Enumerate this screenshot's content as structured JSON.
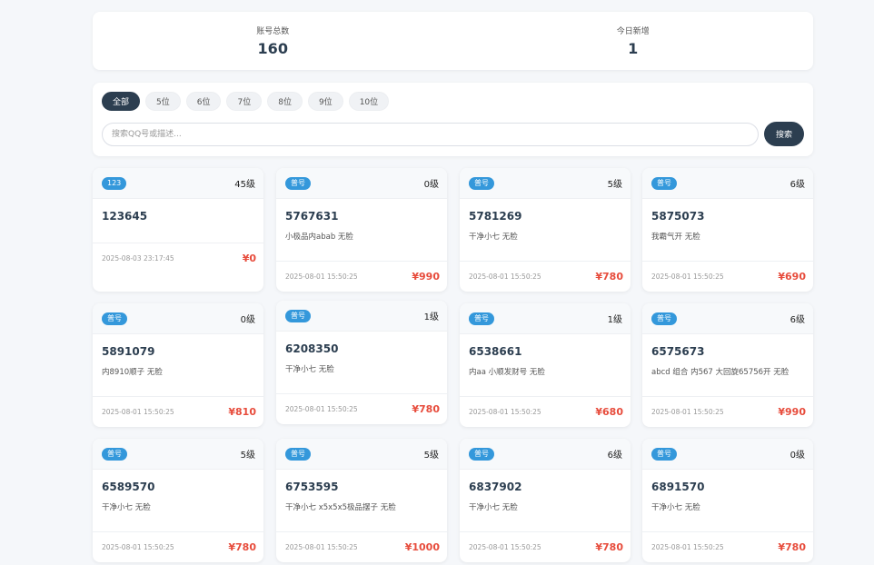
{
  "stats": {
    "total_label": "账号总数",
    "total_value": "160",
    "today_label": "今日新增",
    "today_value": "1"
  },
  "filters": [
    "全部",
    "5位",
    "6位",
    "7位",
    "8位",
    "9位",
    "10位"
  ],
  "search": {
    "placeholder": "搜索QQ号或描述...",
    "button_label": "搜索"
  },
  "cards": [
    {
      "tag": "123",
      "level": "45级",
      "qq": "123645",
      "desc": "",
      "time": "2025-08-03 23:17:45",
      "price": "¥0"
    },
    {
      "tag": "普号",
      "level": "0级",
      "qq": "5767631",
      "desc": "小极品内abab 无脸",
      "time": "2025-08-01 15:50:25",
      "price": "¥990"
    },
    {
      "tag": "普号",
      "level": "5级",
      "qq": "5781269",
      "desc": "干净小七 无脸",
      "time": "2025-08-01 15:50:25",
      "price": "¥780"
    },
    {
      "tag": "普号",
      "level": "6级",
      "qq": "5875073",
      "desc": "我霸气开 无脸",
      "time": "2025-08-01 15:50:25",
      "price": "¥690"
    },
    {
      "tag": "普号",
      "level": "0级",
      "qq": "5891079",
      "desc": "内8910顺子 无脸",
      "time": "2025-08-01 15:50:25",
      "price": "¥810"
    },
    {
      "tag": "普号",
      "level": "1级",
      "qq": "6208350",
      "desc": "干净小七 无脸",
      "time": "2025-08-01 15:50:25",
      "price": "¥780"
    },
    {
      "tag": "普号",
      "level": "1级",
      "qq": "6538661",
      "desc": "内aa 小顺发财号 无脸",
      "time": "2025-08-01 15:50:25",
      "price": "¥680"
    },
    {
      "tag": "普号",
      "level": "6级",
      "qq": "6575673",
      "desc": "abcd 组合 内567 大回旋65756开 无脸",
      "time": "2025-08-01 15:50:25",
      "price": "¥990"
    },
    {
      "tag": "普号",
      "level": "5级",
      "qq": "6589570",
      "desc": "干净小七 无脸",
      "time": "2025-08-01 15:50:25",
      "price": "¥780"
    },
    {
      "tag": "普号",
      "level": "5级",
      "qq": "6753595",
      "desc": "干净小七 x5x5x5极品摆子 无脸",
      "time": "2025-08-01 15:50:25",
      "price": "¥1000"
    },
    {
      "tag": "普号",
      "level": "6级",
      "qq": "6837902",
      "desc": "干净小七 无脸",
      "time": "2025-08-01 15:50:25",
      "price": "¥780"
    },
    {
      "tag": "普号",
      "level": "0级",
      "qq": "6891570",
      "desc": "干净小七 无脸",
      "time": "2025-08-01 15:50:25",
      "price": "¥780"
    }
  ],
  "colors": {
    "primary": "#2c3e50",
    "badge": "#3498db",
    "price": "#e74c3c"
  }
}
